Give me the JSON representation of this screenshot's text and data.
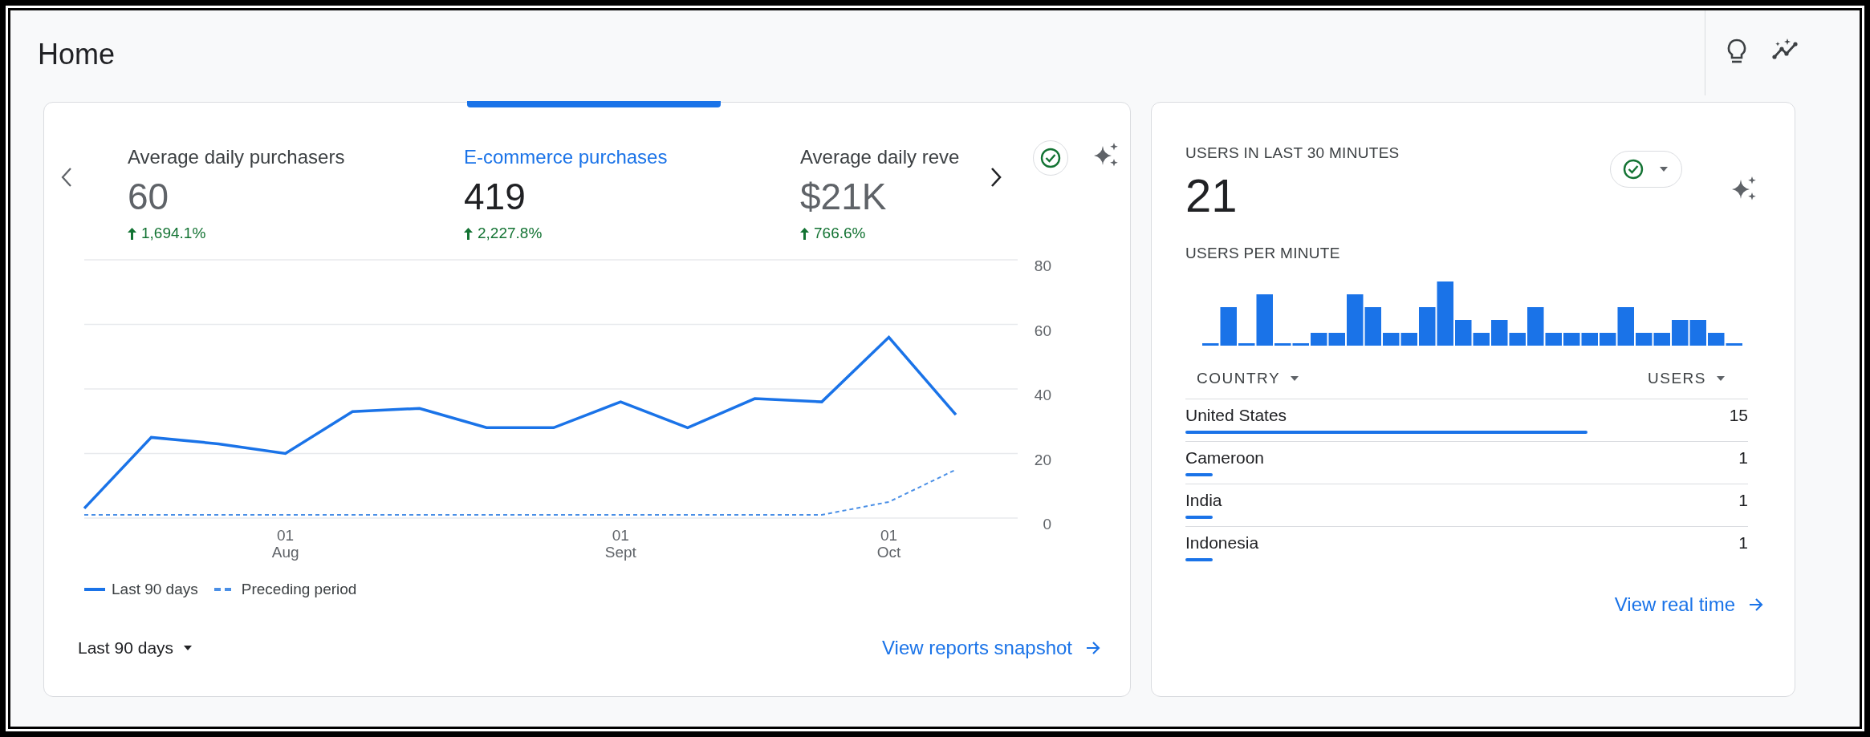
{
  "page": {
    "title": "Home"
  },
  "overview_card": {
    "metrics": [
      {
        "label": "Average daily purchasers",
        "value": "60",
        "change": "1,694.1%",
        "selected": false
      },
      {
        "label": "E-commerce purchases",
        "value": "419",
        "change": "2,227.8%",
        "selected": true
      },
      {
        "label": "Average daily reve",
        "value": "$21K",
        "change": "766.6%",
        "selected": false
      }
    ],
    "chart_data": {
      "type": "line",
      "categories": [
        null,
        null,
        null,
        "01 Aug",
        null,
        null,
        null,
        null,
        "01 Sept",
        null,
        null,
        null,
        "01 Oct",
        null
      ],
      "ylim": [
        0,
        80
      ],
      "yticks": [
        0,
        20,
        40,
        60,
        80
      ],
      "grid": true,
      "series": [
        {
          "name": "Last 90 days",
          "color": "#1a73e8",
          "line_style": "solid",
          "values": [
            3,
            25,
            23,
            20,
            33,
            34,
            28,
            28,
            36,
            28,
            37,
            36,
            56,
            32
          ]
        },
        {
          "name": "Preceding period",
          "color": "#4a8fe6",
          "line_style": "dashed",
          "values": [
            1,
            1,
            1,
            1,
            1,
            1,
            1,
            1,
            1,
            1,
            1,
            1,
            5,
            15
          ]
        }
      ]
    },
    "date_range": "Last 90 days",
    "link": "View reports snapshot"
  },
  "realtime_card": {
    "title": "USERS IN LAST 30 MINUTES",
    "value": "21",
    "subtitle": "USERS PER MINUTE",
    "columns": [
      "COUNTRY",
      "USERS"
    ],
    "rows": [
      {
        "country": "United States",
        "users": "15",
        "level": 0.715
      },
      {
        "country": "Cameroon",
        "users": "1",
        "level": 0.048
      },
      {
        "country": "India",
        "users": "1",
        "level": 0.048
      },
      {
        "country": "Indonesia",
        "users": "1",
        "level": 0.048
      }
    ],
    "link": "View real time"
  }
}
